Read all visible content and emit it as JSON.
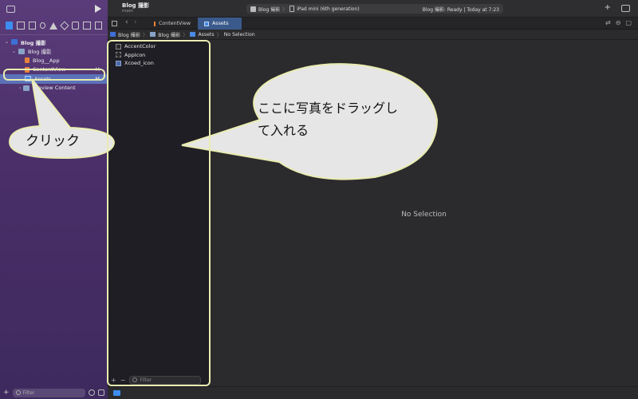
{
  "toolbar": {
    "project_title": "Blog 撮影",
    "branch": "main",
    "scheme_project": "Blog 撮影",
    "device": "iPad mini (6th generation)",
    "status": "Blog 撮影: Ready | Today at 7:23"
  },
  "tabs": [
    {
      "label": "ContentView"
    },
    {
      "label": "Assets"
    }
  ],
  "jumpbar": {
    "crumbs": [
      "Blog 撮影",
      "Blog 撮影",
      "Assets",
      "No Selection"
    ]
  },
  "navigator": {
    "rows": [
      {
        "label": "Blog 撮影",
        "badge": ""
      },
      {
        "label": "Blog 撮影",
        "badge": ""
      },
      {
        "label": "Blog__App",
        "badge": ""
      },
      {
        "label": "ContentView",
        "badge": "M"
      },
      {
        "label": "Assets",
        "badge": "M"
      },
      {
        "label": "Preview Content",
        "badge": ""
      }
    ],
    "filter_placeholder": "Filter"
  },
  "assets": {
    "items": [
      {
        "label": "AccentColor"
      },
      {
        "label": "AppIcon"
      },
      {
        "label": "Xcoed_icon"
      }
    ],
    "filter_placeholder": "Filter"
  },
  "detail": {
    "empty_label": "No Selection"
  },
  "annotations": {
    "click_label": "クリック",
    "drag_label_line1": "ここに写真をドラッグし",
    "drag_label_line2": "て入れる"
  },
  "colors": {
    "highlight": "#e9ecb0",
    "bubble": "#e6e6e6",
    "selection": "#5b72b8"
  }
}
